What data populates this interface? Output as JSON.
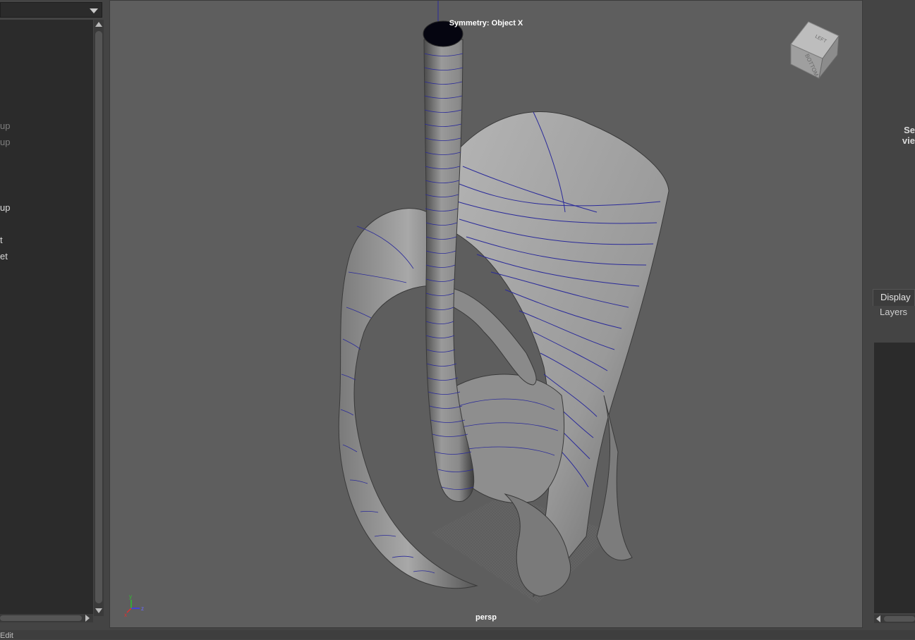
{
  "outliner": {
    "items": [
      {
        "label": "up",
        "state": "dim"
      },
      {
        "label": "up",
        "state": "dim"
      },
      {
        "label": "up",
        "state": "bright"
      },
      {
        "label": "t",
        "state": "bright"
      },
      {
        "label": "et",
        "state": "bright"
      }
    ]
  },
  "viewport": {
    "symmetry_label": "Symmetry: Object X",
    "camera_label": "persp",
    "viewcube": {
      "top_face": "LEFT",
      "side_face": "BOTTOM"
    },
    "axis": {
      "x": "x",
      "y": "y",
      "z": "z"
    }
  },
  "right_panel": {
    "hint_line1": "Se",
    "hint_line2": "vie",
    "tab_label": "Display",
    "menu_label": "Layers"
  },
  "bottom_bar": {
    "text": "Edit"
  },
  "colors": {
    "viewport_bg": "#5e5e5e",
    "panel_bg": "#444444",
    "list_bg": "#2b2b2b",
    "wire": "#2a2a9a"
  }
}
